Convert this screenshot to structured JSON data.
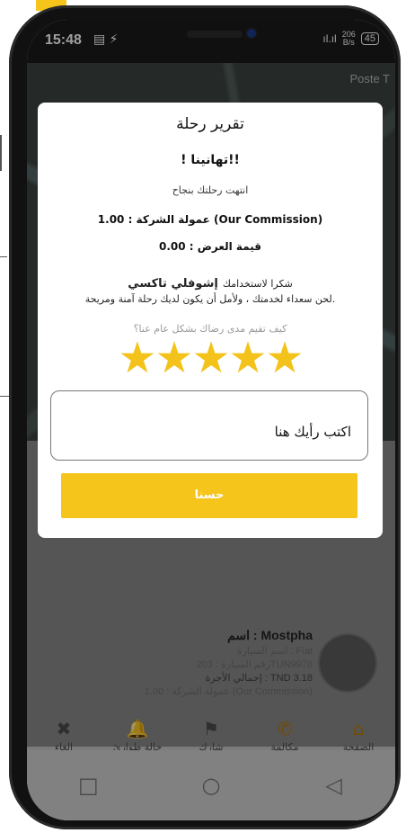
{
  "accent_color": "#f5c51c",
  "status_bar": {
    "time": "15:48",
    "left_icons": "▤ ⚡",
    "signal": "ıl.ıl",
    "speed_value": "206",
    "speed_unit": "B/s",
    "battery": "45"
  },
  "map": {
    "label": "Poste T"
  },
  "dialog": {
    "title": "تقرير رحلة",
    "congrats": "! تهانينا!!",
    "trip_ended": "انتهت رحلتك بنجاح",
    "commission": "عمولة الشركة : 1.00 (Our Commission)",
    "bid_value": "قيمة العرض : 0.00",
    "thanks_prefix": "شكرا لاستخدامك",
    "brand": "إشوفلي تاكسي",
    "happy_line": "لحن سعداء لخدمتك ، ولأمل أن يكون لديك رحلة آمنة ومريحة.",
    "rating_question": "كيف تقيم مدى رضاك بشكل عام عنا؟",
    "rating_stars": 5,
    "stars_text": "★★★★★",
    "feedback_placeholder": "اكتب رأيك هنا",
    "ok_button": "حسنا"
  },
  "driver": {
    "name": "اسم : Mostpha",
    "car_name": "اسم السيارة : Fiat",
    "car_number": "رقم السيارة : 203TUN9978",
    "total_fare": "إجمالي الأجرة : TND 3.18",
    "commission": "عمولة الشركة : 1.00 (Our Commission)"
  },
  "bottom_nav": {
    "cancel": "إلغاء",
    "emergency": "حالة طوارئ",
    "share": "شارك",
    "call": "مكالمة",
    "home": "الصفحة الرئيسية"
  },
  "icons": {
    "cancel": "✖",
    "emergency": "🔔",
    "share": "⚑",
    "call": "✆",
    "home": "⌂",
    "recent": "□",
    "home_sys": "○",
    "back": "◁"
  }
}
